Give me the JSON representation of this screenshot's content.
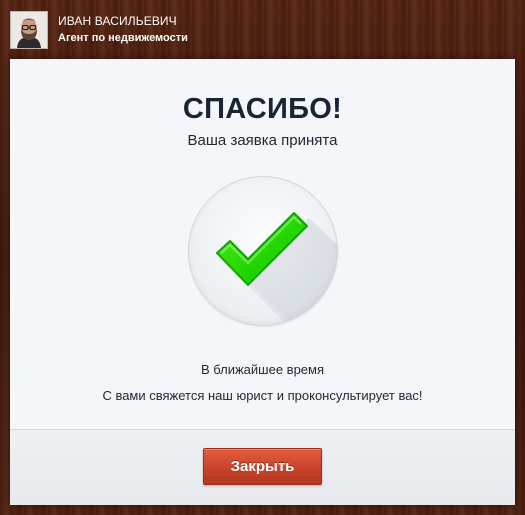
{
  "agent": {
    "name": "ИВАН ВАСИЛЬЕВИЧ",
    "role": "Агент по недвижемости",
    "avatar_icon": "avatar-photo"
  },
  "dialog": {
    "title": "СПАСИБО!",
    "subtitle": "Ваша заявка принята",
    "status_icon": "checkmark-icon",
    "message_line1": "В ближайшее время",
    "message_line2": "С вами свяжется наш юрист и проконсультирует вас!",
    "close_label": "Закрыть"
  },
  "colors": {
    "button": "#c8432a",
    "check": "#22cc00",
    "title": "#1a2435",
    "dialog_bg": "#f4f6f9"
  }
}
